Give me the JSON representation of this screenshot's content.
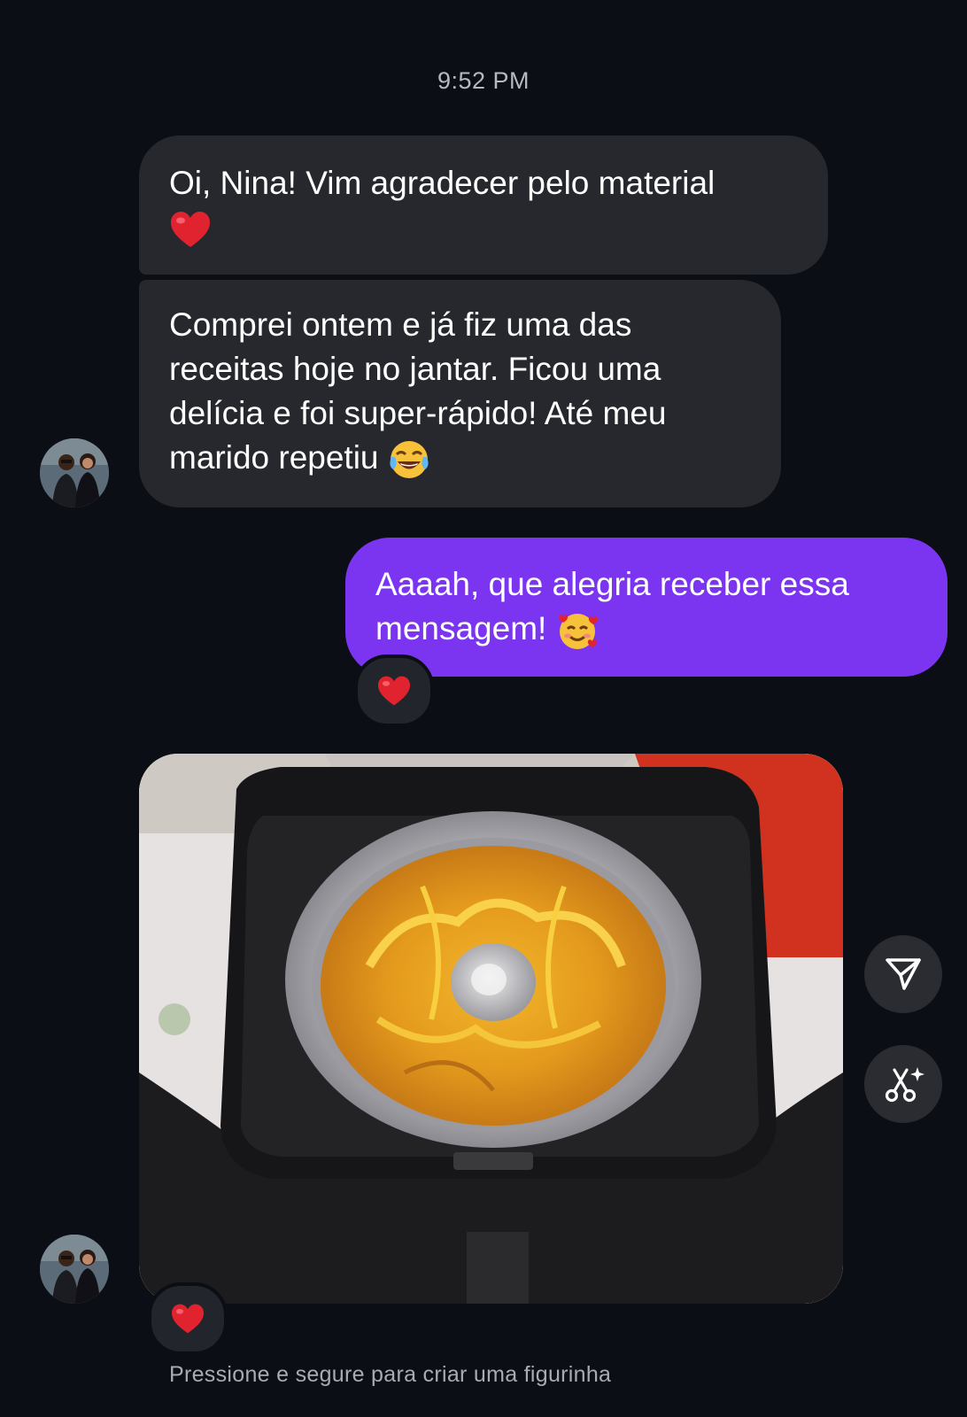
{
  "thread": {
    "timestamp": "9:52 PM"
  },
  "messages": [
    {
      "sender": "contact",
      "text": "Oi, Nina! Vim agradecer pelo material",
      "emoji": "red-heart"
    },
    {
      "sender": "contact",
      "text": "Comprei ontem e já fiz uma das receitas hoje no jantar. Ficou uma delícia e foi super-rápido! Até meu marido repetiu",
      "emoji": "face-with-tears-of-joy"
    },
    {
      "sender": "me",
      "text": "Aaaah, que alegria receber essa mensagem!",
      "emoji": "smiling-face-with-hearts",
      "reaction": "red-heart"
    },
    {
      "sender": "contact",
      "type": "photo",
      "photo_subject": "cake-in-air-fryer",
      "reaction": "red-heart"
    }
  ],
  "actions": {
    "share_icon": "send-icon",
    "sticker_icon": "scissors-sparkle-icon"
  },
  "hint": {
    "text": "Pressione e segure para criar uma figurinha"
  },
  "colors": {
    "background": "#0b0e14",
    "incoming_bubble": "#26282e",
    "outgoing_bubble": "#7b35f0",
    "reaction_bg": "#22252b",
    "hint_text": "#a8abb2"
  }
}
